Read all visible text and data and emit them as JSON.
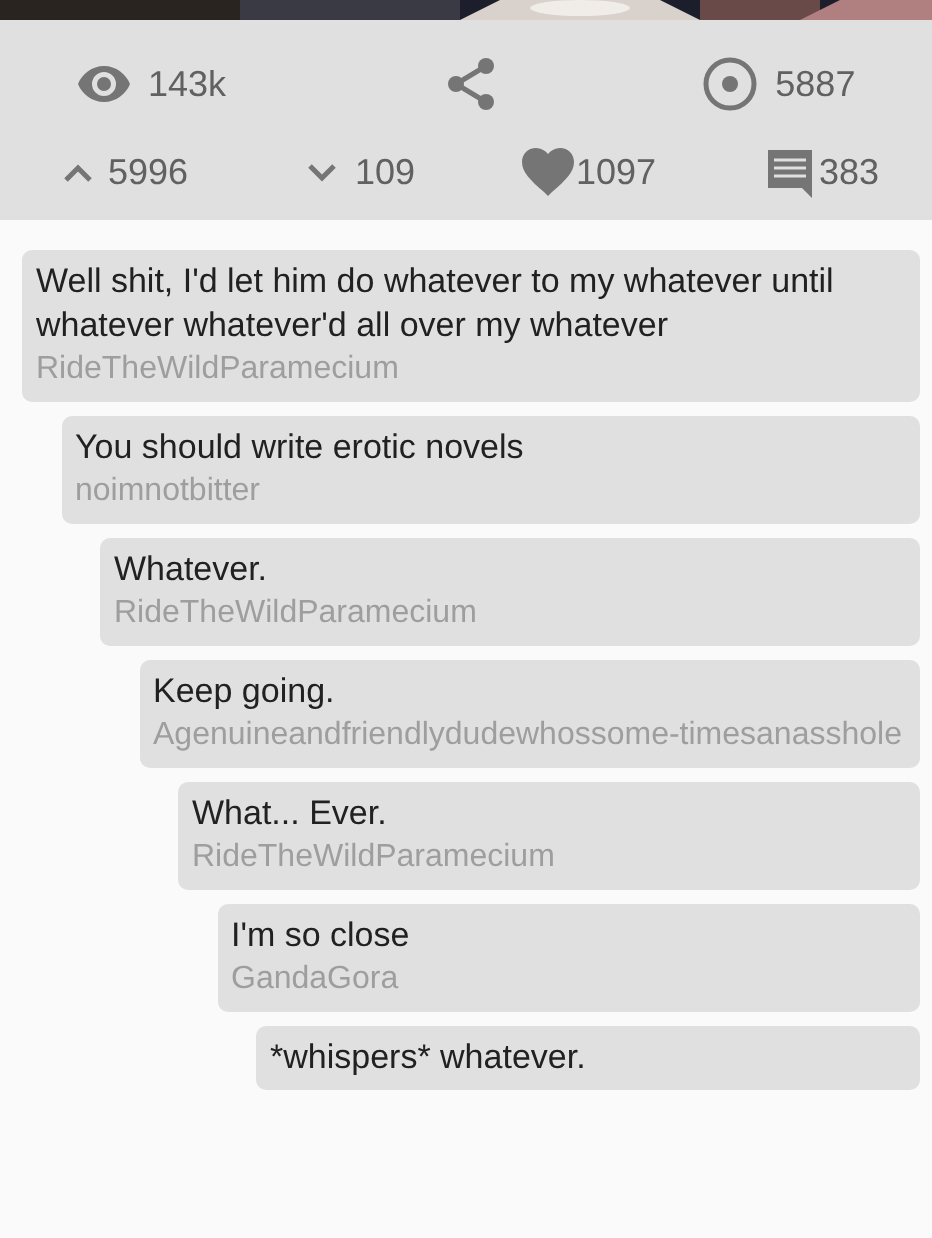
{
  "stats": {
    "views": "143k",
    "score": "5887",
    "upvotes": "5996",
    "downvotes": "109",
    "favorites": "1097",
    "comments": "383"
  },
  "thread": [
    {
      "body": "Well shit, I'd let him do whatever to my whatever until whatever whatever'd all over my whatever",
      "author": "RideTheWildParamecium",
      "children": [
        {
          "body": "You should write erotic novels",
          "author": "noimnotbitter",
          "children": [
            {
              "body": "Whatever.",
              "author": "RideTheWildParamecium",
              "children": [
                {
                  "body": "Keep going.",
                  "author": "Agenuineandfriendlydudewhossome-timesanasshole",
                  "children": [
                    {
                      "body": "What... Ever.",
                      "author": "RideTheWildParamecium",
                      "children": [
                        {
                          "body": "I'm so close",
                          "author": "GandaGora",
                          "children": [
                            {
                              "body": "*whispers* whatever."
                            }
                          ]
                        }
                      ]
                    }
                  ]
                }
              ]
            }
          ]
        }
      ]
    }
  ]
}
